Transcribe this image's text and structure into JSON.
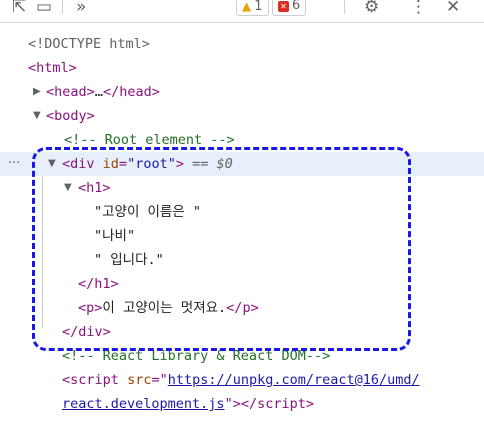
{
  "toolbar": {
    "inspect_icon": "element-picker-icon",
    "device_icon": "device-toolbar-icon",
    "more_tabs_label": "»",
    "warnings_count": "1",
    "errors_count": "6",
    "settings_icon": "gear-icon",
    "menu_icon": "kebab-menu-icon",
    "close_icon": "close-icon",
    "colors": {
      "warning": "#e8a300",
      "error": "#d93025"
    }
  },
  "dom": {
    "doctype": "<!DOCTYPE html>",
    "html_open_tag": "html",
    "head_open": "head",
    "head_ellipsis": "…",
    "head_close": "head",
    "body_open": "body",
    "comment_root": "<!-- Root element -->",
    "div_tag": "div",
    "div_attr_name": "id",
    "div_attr_value": "\"root\"",
    "selected_marker": "== $0",
    "h1_tag": "h1",
    "text_1": "\"고양이 이름은 \"",
    "text_2": "\"나비\"",
    "text_3": "\" 입니다.\"",
    "h1_close": "h1",
    "p_tag": "p",
    "p_text": "이 고양이는 멋져요.",
    "p_close": "p",
    "div_close": "div",
    "comment_react": "<!-- React Library & React DOM-->",
    "script_tag": "script",
    "script_attr_name": "src",
    "script_src_part1": "https://unpkg.com/react@16/umd/",
    "script_src_part2": "react.development.js",
    "script_close": "script"
  },
  "accent": {
    "selection_bg": "#e7effa",
    "annotation_box": "#1a18e8"
  }
}
